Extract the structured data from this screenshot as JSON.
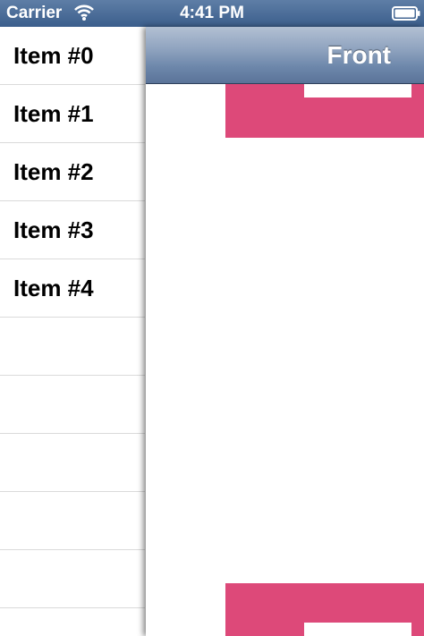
{
  "status_bar": {
    "carrier": "Carrier",
    "time": "4:41 PM",
    "icons": [
      "wifi-icon",
      "battery-icon"
    ]
  },
  "menu": {
    "items": [
      {
        "label": "Item #0"
      },
      {
        "label": "Item #1"
      },
      {
        "label": "Item #2"
      },
      {
        "label": "Item #3"
      },
      {
        "label": "Item #4"
      },
      {
        "label": ""
      },
      {
        "label": ""
      },
      {
        "label": ""
      },
      {
        "label": ""
      },
      {
        "label": ""
      }
    ]
  },
  "front": {
    "title": "Front"
  },
  "colors": {
    "status_bar": "#3b5e8c",
    "nav_bar": "#6e88ab",
    "accent_block": "#dd4979",
    "separator": "#dadada"
  }
}
